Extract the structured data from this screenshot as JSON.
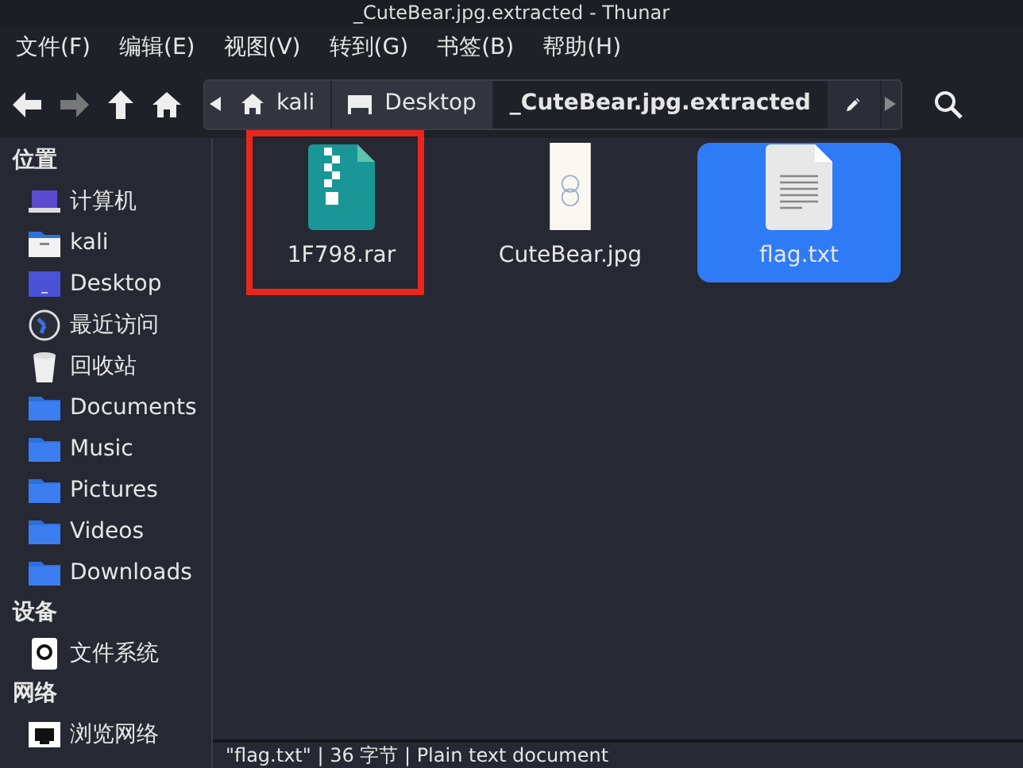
{
  "window": {
    "title": "_CuteBear.jpg.extracted - Thunar"
  },
  "menu": [
    "文件(F)",
    "编辑(E)",
    "视图(V)",
    "转到(G)",
    "书签(B)",
    "帮助(H)"
  ],
  "toolbar": {
    "back_disabled": false,
    "forward_disabled": true
  },
  "path": [
    {
      "label": "kali",
      "kind": "home",
      "selected": false
    },
    {
      "label": "Desktop",
      "kind": "desktop",
      "selected": false
    },
    {
      "label": "_CuteBear.jpg.extracted",
      "kind": "plain",
      "selected": true
    }
  ],
  "sidebar": [
    {
      "heading": "位置",
      "items": [
        {
          "label": "计算机",
          "kind": "computer"
        },
        {
          "label": "kali",
          "kind": "home"
        },
        {
          "label": "Desktop",
          "kind": "desktop"
        },
        {
          "label": "最近访问",
          "kind": "recent"
        },
        {
          "label": "回收站",
          "kind": "trash"
        },
        {
          "label": "Documents",
          "kind": "folder"
        },
        {
          "label": "Music",
          "kind": "folder"
        },
        {
          "label": "Pictures",
          "kind": "folder"
        },
        {
          "label": "Videos",
          "kind": "folder"
        },
        {
          "label": "Downloads",
          "kind": "folder"
        }
      ]
    },
    {
      "heading": "设备",
      "items": [
        {
          "label": "文件系统",
          "kind": "drive"
        }
      ]
    },
    {
      "heading": "网络",
      "items": [
        {
          "label": "浏览网络",
          "kind": "network"
        }
      ]
    }
  ],
  "files": [
    {
      "name": "1F798.rar",
      "kind": "archive",
      "selected": false,
      "highlighted": true
    },
    {
      "name": "CuteBear.jpg",
      "kind": "image",
      "selected": false,
      "highlighted": false
    },
    {
      "name": "flag.txt",
      "kind": "text",
      "selected": true,
      "highlighted": false
    }
  ],
  "status_bar": "\"flag.txt\" | 36 字节 | Plain text document"
}
